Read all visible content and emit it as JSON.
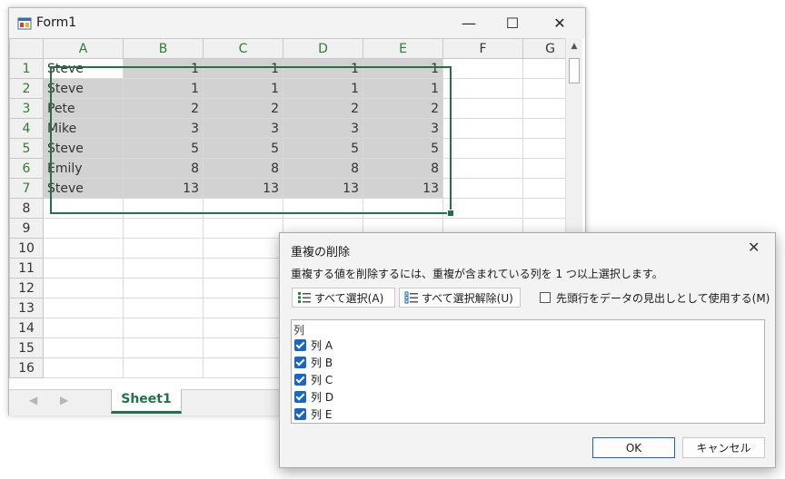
{
  "window": {
    "title": "Form1",
    "minimize": "—",
    "maximize": "☐",
    "close": "✕"
  },
  "grid": {
    "columns": [
      "A",
      "B",
      "C",
      "D",
      "E",
      "F",
      "G"
    ],
    "rows": [
      [
        "Steve",
        "1",
        "1",
        "1",
        "1"
      ],
      [
        "Steve",
        "1",
        "1",
        "1",
        "1"
      ],
      [
        "Pete",
        "2",
        "2",
        "2",
        "2"
      ],
      [
        "Mike",
        "3",
        "3",
        "3",
        "3"
      ],
      [
        "Steve",
        "5",
        "5",
        "5",
        "5"
      ],
      [
        "Emily",
        "8",
        "8",
        "8",
        "8"
      ],
      [
        "Steve",
        "13",
        "13",
        "13",
        "13"
      ]
    ],
    "row_numbers": [
      "1",
      "2",
      "3",
      "4",
      "5",
      "6",
      "7",
      "8",
      "9",
      "10",
      "11",
      "12",
      "13",
      "14",
      "15",
      "16"
    ]
  },
  "tabs": {
    "prev": "◀",
    "next": "▶",
    "sheet": "Sheet1"
  },
  "dialog": {
    "title": "重複の削除",
    "close": "✕",
    "instruction": "重複する値を削除するには、重複が含まれている列を 1 つ以上選択します。",
    "select_all": "すべて選択(A)",
    "unselect_all": "すべて選択解除(U)",
    "header_option": "先頭行をデータの見出しとして使用する(M)",
    "list_header": "列",
    "items": [
      "列 A",
      "列 B",
      "列 C",
      "列 D",
      "列 E"
    ],
    "ok": "OK",
    "cancel": "キャンセル"
  }
}
